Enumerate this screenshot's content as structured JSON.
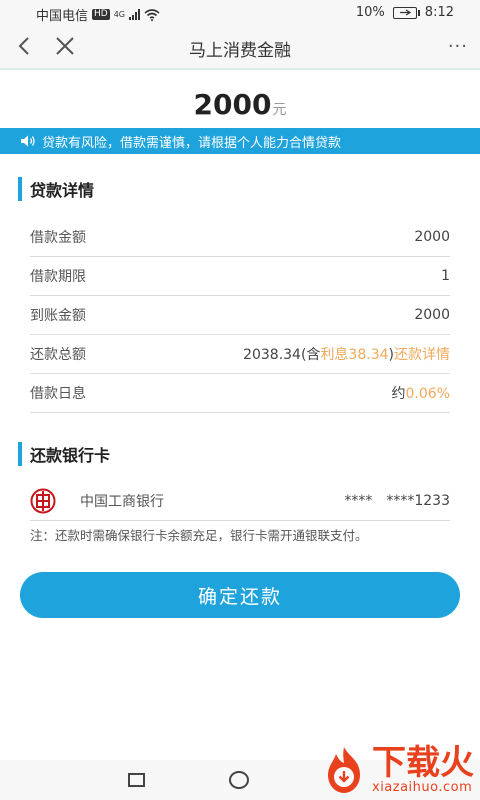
{
  "status_bar": {
    "carrier": "中国电信",
    "hd": "HD",
    "network": "4G",
    "battery": "10%",
    "time": "8:12"
  },
  "nav": {
    "title": "马上消费金融",
    "more": "···"
  },
  "amount": {
    "value": "2000",
    "unit": "元"
  },
  "warning": {
    "text": "贷款有风险，借款需谨慎，请根据个人能力合情贷款"
  },
  "loan_details": {
    "title": "贷款详情",
    "rows": [
      {
        "label": "借款金额",
        "value": "2000"
      },
      {
        "label": "借款期限",
        "value": "1"
      },
      {
        "label": "到账金额",
        "value": "2000"
      }
    ],
    "total_repayment": {
      "label": "还款总额",
      "value": "2038.34",
      "interest_open": "(含",
      "interest": "利息38.34",
      "interest_close": ")",
      "detail_link": "还款详情"
    },
    "daily_interest": {
      "label": "借款日息",
      "prefix": "约",
      "rate": "0.06%"
    }
  },
  "bank_card": {
    "title": "还款银行卡",
    "bank_name": "中国工商银行",
    "mask": "****",
    "card_last": "****1233"
  },
  "note": "注：还款时需确保银行卡余额充足，银行卡需开通银联支付。",
  "confirm_button": "确定还款",
  "watermark": {
    "main": "下载火",
    "sub": "xiazaihuo.com"
  },
  "colors": {
    "accent": "#1fa3dc",
    "orange": "#f0a95a",
    "watermark": "#e8411e"
  }
}
